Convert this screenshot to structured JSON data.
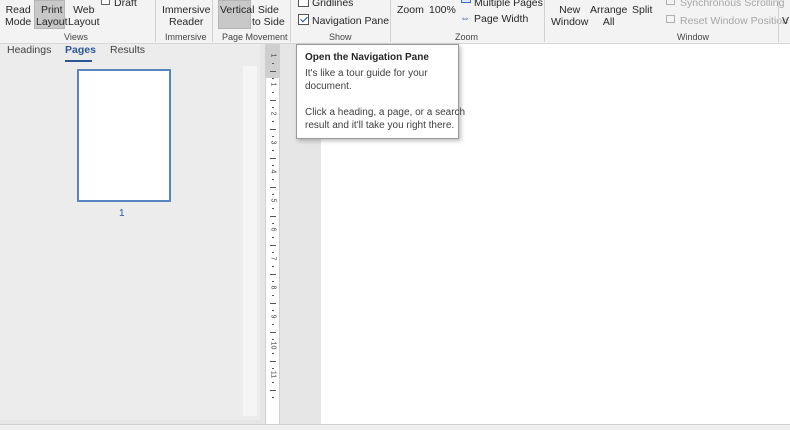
{
  "ribbon": {
    "views": {
      "read_mode": [
        "Read",
        "Mode"
      ],
      "print_layout": [
        "Print",
        "Layout"
      ],
      "web_layout": [
        "Web",
        "Layout"
      ],
      "draft": "Draft",
      "group": "Views"
    },
    "immersive": {
      "reader": [
        "Immersive",
        "Reader"
      ],
      "group": "Immersive"
    },
    "page_movement": {
      "vertical": "Vertical",
      "side_to_side": [
        "Side",
        "to Side"
      ],
      "group": "Page Movement"
    },
    "show": {
      "gridlines": "Gridlines",
      "gridlines_checked": false,
      "navigation_pane": "Navigation Pane",
      "navigation_pane_checked": true,
      "group": "Show"
    },
    "zoom": {
      "zoom": "Zoom",
      "hundred": "100%",
      "multiple_pages": "Multiple Pages",
      "page_width": "Page Width",
      "group": "Zoom"
    },
    "window": {
      "new_window": [
        "New",
        "Window"
      ],
      "arrange_all": [
        "Arrange",
        "All"
      ],
      "split": "Split",
      "sync_scrolling": "Synchronous Scrolling",
      "reset_window": "Reset Window Position",
      "group": "Window"
    },
    "overflow": "V"
  },
  "nav_pane": {
    "tabs": [
      "Headings",
      "Pages",
      "Results"
    ],
    "active_tab": "Pages",
    "page_number": "1"
  },
  "ruler": {
    "numbers": [
      "1",
      "1",
      "2",
      "3",
      "4",
      "5",
      "6",
      "7",
      "8",
      "9",
      "10",
      "11"
    ]
  },
  "tooltip": {
    "title": "Open the Navigation Pane",
    "lines": [
      "It's like a tour guide for your",
      "document.",
      "Click a heading, a page, or a search",
      "result and it'll take you right there."
    ]
  },
  "colors": {
    "accent": "#2b579a",
    "ribbon_bg": "#f3f3f3",
    "pane_bg": "#ececec"
  }
}
